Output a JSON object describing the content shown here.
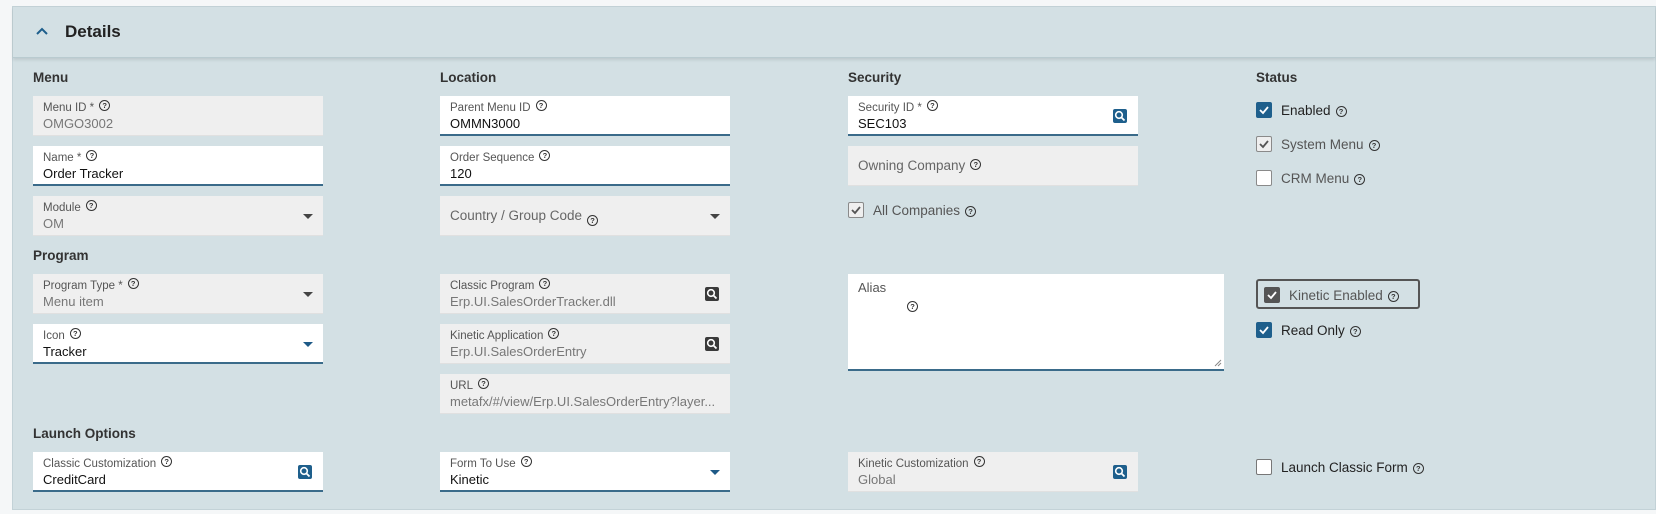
{
  "panel": {
    "title": "Details"
  },
  "sections": {
    "menu": "Menu",
    "location": "Location",
    "security": "Security",
    "status": "Status",
    "program": "Program",
    "launch_options": "Launch Options"
  },
  "fields": {
    "menu_id": {
      "label": "Menu ID *",
      "value": "OMGO3002"
    },
    "name": {
      "label": "Name *",
      "value": "Order Tracker"
    },
    "module": {
      "label": "Module",
      "value": "OM"
    },
    "parent_menu_id": {
      "label": "Parent Menu ID",
      "value": "OMMN3000"
    },
    "order_sequence": {
      "label": "Order Sequence",
      "value": "120"
    },
    "country_group_code": {
      "label": "Country / Group Code",
      "value": ""
    },
    "security_id": {
      "label": "Security ID *",
      "value": "SEC103"
    },
    "owning_company": {
      "label": "Owning Company",
      "value": ""
    },
    "program_type": {
      "label": "Program Type *",
      "value": "Menu item"
    },
    "icon": {
      "label": "Icon",
      "value": "Tracker"
    },
    "classic_program": {
      "label": "Classic Program",
      "value": "Erp.UI.SalesOrderTracker.dll"
    },
    "kinetic_application": {
      "label": "Kinetic Application",
      "value": "Erp.UI.SalesOrderEntry"
    },
    "url": {
      "label": "URL",
      "value": "metafx/#/view/Erp.UI.SalesOrderEntry?layer..."
    },
    "alias": {
      "label": "Alias",
      "value": ""
    },
    "classic_customization": {
      "label": "Classic Customization",
      "value": "CreditCard"
    },
    "form_to_use": {
      "label": "Form To Use",
      "value": "Kinetic"
    },
    "kinetic_customization": {
      "label": "Kinetic Customization",
      "value": "Global"
    }
  },
  "checkboxes": {
    "all_companies": {
      "label": "All Companies",
      "checked": true
    },
    "enabled": {
      "label": "Enabled",
      "checked": true
    },
    "system_menu": {
      "label": "System Menu",
      "checked": true
    },
    "crm_menu": {
      "label": "CRM Menu",
      "checked": false
    },
    "kinetic_enabled": {
      "label": "Kinetic Enabled",
      "checked": true
    },
    "read_only": {
      "label": "Read Only",
      "checked": true
    },
    "launch_classic_form": {
      "label": "Launch Classic Form",
      "checked": false
    }
  },
  "colors": {
    "accent": "#1e5f8c",
    "panel_bg": "#d3e0e4",
    "field_readonly": "#efefef"
  },
  "icons": [
    "chevron-up-icon",
    "help-icon",
    "dropdown-arrow-icon",
    "search-lookup-icon",
    "checkmark-icon"
  ]
}
